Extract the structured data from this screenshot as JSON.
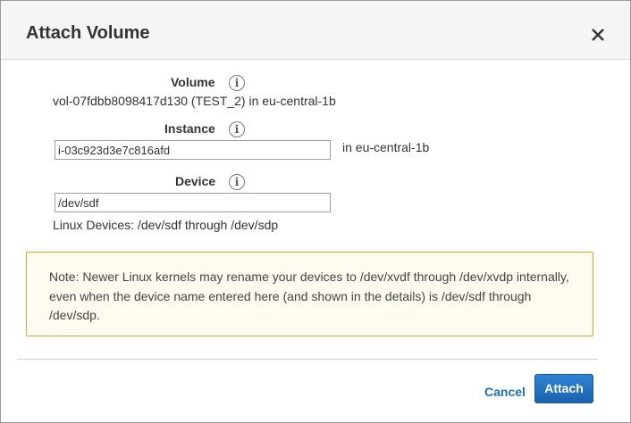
{
  "dialog": {
    "title": "Attach Volume",
    "close_icon": "close-icon"
  },
  "volume": {
    "label": "Volume",
    "value": "vol-07fdbb8098417d130 (TEST_2) in eu-central-1b"
  },
  "instance": {
    "label": "Instance",
    "value": "i-03c923d3e7c816afd",
    "zone_text": "in eu-central-1b"
  },
  "device": {
    "label": "Device",
    "value": "/dev/sdf",
    "hint": "Linux Devices: /dev/sdf through /dev/sdp"
  },
  "note": {
    "text": "Note: Newer Linux kernels may rename your devices to /dev/xvdf through /dev/xvdp internally, even when the device name entered here (and shown in the details) is /dev/sdf through /dev/sdp."
  },
  "footer": {
    "cancel_label": "Cancel",
    "attach_label": "Attach"
  },
  "info_glyph": "i",
  "colors": {
    "accent": "#1d6dbf",
    "note_border": "#e0a030",
    "note_background": "#fffbf0"
  }
}
